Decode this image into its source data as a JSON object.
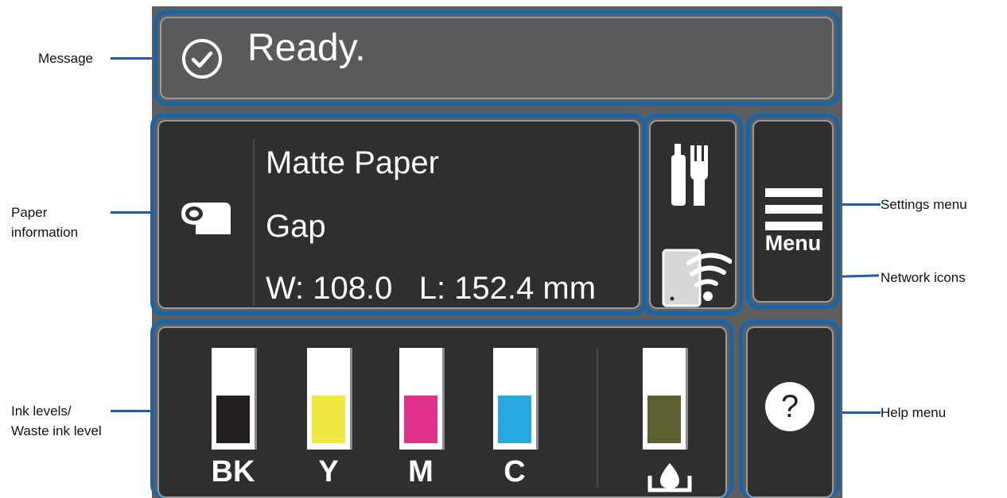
{
  "annotations": {
    "message": "Message",
    "paper_info_line1": "Paper",
    "paper_info_line2": "information",
    "ink_levels_line1": "Ink levels/",
    "ink_levels_line2": "Waste ink level",
    "settings_menu": "Settings menu",
    "network_icons": "Network icons",
    "help_menu": "Help menu"
  },
  "message": {
    "icon": "check-circle-icon",
    "text": "Ready."
  },
  "paper": {
    "icon": "paper-roll-icon",
    "name": "Matte Paper",
    "type": "Gap",
    "size": "W: 108.0   L: 152.4 mm"
  },
  "network": {
    "icons": [
      "wired-network-icon",
      "wireless-direct-icon"
    ]
  },
  "menu": {
    "icon": "hamburger-menu-icon",
    "label": "Menu"
  },
  "help": {
    "icon": "question-icon",
    "label": "?"
  },
  "inks": [
    {
      "label": "BK",
      "color": "#231f20",
      "level": 0.5
    },
    {
      "label": "Y",
      "color": "#f2e642",
      "level": 0.5
    },
    {
      "label": "M",
      "color": "#e0318d",
      "level": 0.5
    },
    {
      "label": "C",
      "color": "#27a9e0",
      "level": 0.5
    }
  ],
  "waste_ink": {
    "icon": "waste-ink-drop-icon",
    "color": "#5d5f33",
    "level": 0.5
  }
}
